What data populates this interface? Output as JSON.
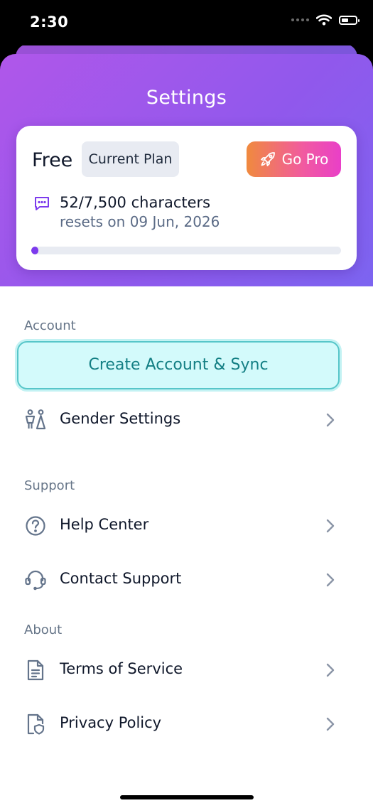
{
  "status_bar": {
    "time": "2:30",
    "icons": [
      "signal-dots-icon",
      "wifi-icon",
      "battery-icon"
    ]
  },
  "header": {
    "title": "Settings"
  },
  "plan": {
    "name": "Free",
    "badge": "Current Plan",
    "upgrade_label": "Go Pro",
    "usage_text": "52/7,500 characters",
    "reset_text": "resets on 09 Jun, 2026",
    "usage_used": 52,
    "usage_limit": 7500
  },
  "account": {
    "label": "Account",
    "create_button": "Create Account & Sync",
    "items": [
      {
        "label": "Gender Settings",
        "icon": "gender-icon"
      }
    ]
  },
  "support": {
    "label": "Support",
    "items": [
      {
        "label": "Help Center",
        "icon": "help-circle-icon"
      },
      {
        "label": "Contact Support",
        "icon": "headset-icon"
      }
    ]
  },
  "about": {
    "label": "About",
    "items": [
      {
        "label": "Terms of Service",
        "icon": "document-icon"
      },
      {
        "label": "Privacy Policy",
        "icon": "privacy-document-icon"
      }
    ]
  },
  "colors": {
    "header_gradient_start": "#b057ea",
    "header_gradient_end": "#7c64f0",
    "go_pro_start": "#f08a3e",
    "go_pro_end": "#e93fc8",
    "progress_fill": "#7c3aed",
    "create_button_bg": "#d3fafb",
    "create_button_text": "#137f84"
  }
}
